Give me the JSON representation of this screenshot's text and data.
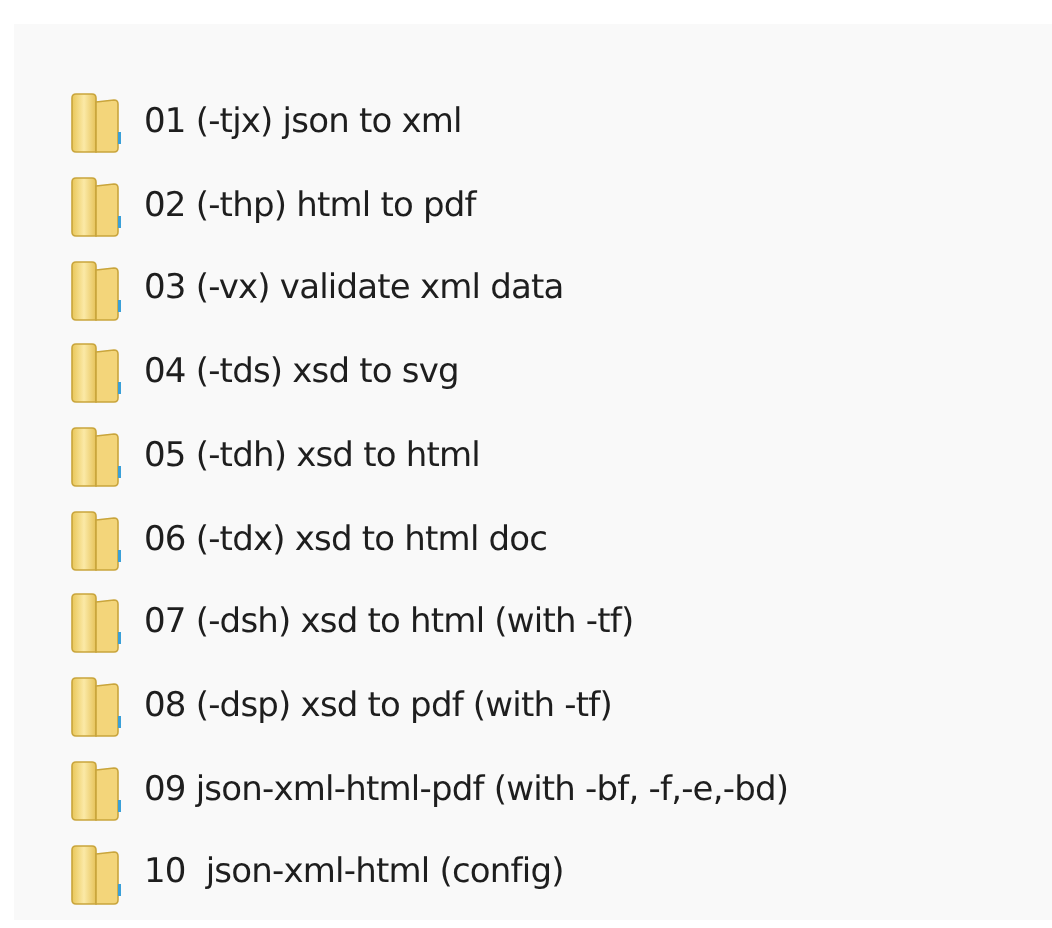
{
  "folders": [
    {
      "name": "01 (-tjx) json to xml"
    },
    {
      "name": "02 (-thp) html to pdf"
    },
    {
      "name": "03 (-vx) validate xml data"
    },
    {
      "name": "04 (-tds) xsd to svg"
    },
    {
      "name": "05 (-tdh) xsd to html"
    },
    {
      "name": "06 (-tdx) xsd to html doc"
    },
    {
      "name": "07 (-dsh) xsd to html (with -tf)"
    },
    {
      "name": "08 (-dsp) xsd to pdf (with -tf)"
    },
    {
      "name": "09 json-xml-html-pdf (with -bf, -f,-e,-bd)"
    },
    {
      "name": "10  json-xml-html (config)"
    }
  ]
}
